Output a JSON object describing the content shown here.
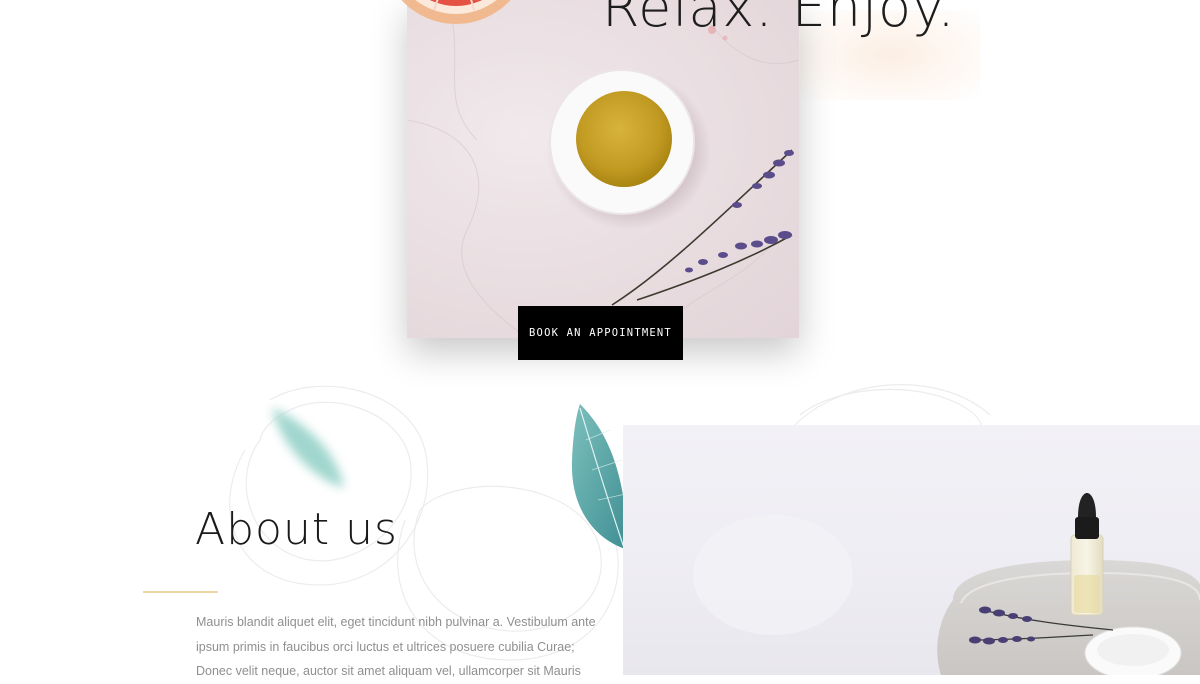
{
  "hero": {
    "headline": "Relax. Enjoy.",
    "cta_label": "BOOK AN APPOINTMENT"
  },
  "about": {
    "title": "About us",
    "body_lines": [
      "Mauris blandit aliquet elit, eget tincidunt nibh pulvinar a. Vestibulum ante",
      "ipsum primis in faucibus orci luctus et ultrices posuere cubilia Curae;",
      "Donec velit neque, auctor sit amet aliquam vel, ullamcorper sit Mauris"
    ]
  },
  "colors": {
    "background": "#ffffff",
    "headline": "#1d1d1d",
    "cta_background": "#000000",
    "cta_text": "#ffffff",
    "accent_divider": "#f0d6a6",
    "body_text": "#8f8f8f",
    "leaf_teal": "#5aa9a8"
  },
  "images": {
    "hero": "marble-oil-bowl-lavender-photo",
    "grapefruit": "grapefruit-slice-image",
    "spa": "spa-oil-dropper-tray-photo",
    "leaf_left": "blurred-leaf-decoration",
    "leaf_right": "teal-leaf-decoration",
    "background_lines": "decorative-line-pattern"
  }
}
